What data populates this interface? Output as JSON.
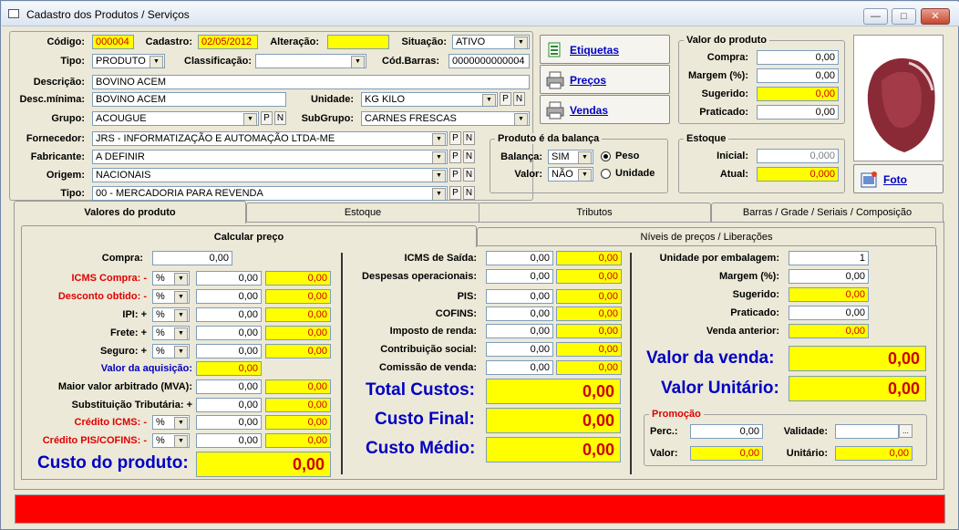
{
  "window": {
    "title": "Cadastro dos Produtos / Serviços",
    "min": "—",
    "max": "□",
    "close": "✕"
  },
  "top": {
    "codigo_label": "Código:",
    "codigo": "000004",
    "cadastro_label": "Cadastro:",
    "cadastro": "02/05/2012",
    "alteracao_label": "Alteração:",
    "alteracao": "",
    "situacao_label": "Situação:",
    "situacao": "ATIVO",
    "tipo_label": "Tipo:",
    "tipo": "PRODUTO",
    "classificacao_label": "Classificação:",
    "classificacao": "",
    "codbarras_label": "Cód.Barras:",
    "codbarras": "0000000000004",
    "descricao_label": "Descrição:",
    "descricao": "BOVINO ACEM",
    "descmin_label": "Desc.mínima:",
    "descmin": "BOVINO ACEM",
    "unidade_label": "Unidade:",
    "unidade": "KG  KILO",
    "grupo_label": "Grupo:",
    "grupo": "ACOUGUE",
    "subgrupo_label": "SubGrupo:",
    "subgrupo": "CARNES FRESCAS",
    "fornecedor_label": "Fornecedor:",
    "fornecedor": "JRS - INFORMATIZAÇÃO E AUTOMAÇÃO LTDA-ME",
    "fabricante_label": "Fabricante:",
    "fabricante": "A DEFINIR",
    "origem_label": "Origem:",
    "origem": "NACIONAIS",
    "tipo2_label": "Tipo:",
    "tipo2": "00 - MERCADORIA PARA REVENDA",
    "p": "P",
    "n": "N"
  },
  "buttons": {
    "etiquetas": "Etiquetas",
    "precos": "Preços",
    "vendas": "Vendas",
    "foto": "Foto"
  },
  "valor_produto": {
    "title": "Valor do produto",
    "compra_label": "Compra:",
    "compra": "0,00",
    "margem_label": "Margem (%):",
    "margem": "0,00",
    "sugerido_label": "Sugerido:",
    "sugerido": "0,00",
    "praticado_label": "Praticado:",
    "praticado": "0,00"
  },
  "balanca": {
    "title": "Produto é da balança",
    "balanca_label": "Balança:",
    "balanca": "SIM",
    "valor_label": "Valor:",
    "valor": "NÃO",
    "peso": "Peso",
    "unidade": "Unidade"
  },
  "estoque": {
    "title": "Estoque",
    "inicial_label": "Inicial:",
    "inicial": "0,000",
    "atual_label": "Atual:",
    "atual": "0,000"
  },
  "tabs": [
    "Valores do produto",
    "Estoque",
    "Tributos",
    "Barras / Grade / Seriais / Composição"
  ],
  "subtabs": [
    "Calcular preço",
    "Níveis de preços / Liberações"
  ],
  "left": {
    "compra_label": "Compra:",
    "compra": "0,00",
    "rows": [
      {
        "label": "ICMS Compra: -",
        "sel": "%",
        "v1": "0,00",
        "v2": "0,00",
        "color": "red"
      },
      {
        "label": "Desconto obtido: -",
        "sel": "%",
        "v1": "0,00",
        "v2": "0,00",
        "color": "red"
      },
      {
        "label": "IPI: +",
        "sel": "%",
        "v1": "0,00",
        "v2": "0,00",
        "color": "black"
      },
      {
        "label": "Frete: +",
        "sel": "%",
        "v1": "0,00",
        "v2": "0,00",
        "color": "black"
      },
      {
        "label": "Seguro: +",
        "sel": "%",
        "v1": "0,00",
        "v2": "0,00",
        "color": "black"
      }
    ],
    "aquisicao_label": "Valor da aquisição:",
    "aquisicao": "0,00",
    "mva_label": "Maior valor arbitrado (MVA):",
    "mva1": "0,00",
    "mva2": "0,00",
    "st_label": "Substituição Tributária: +",
    "st1": "0,00",
    "st2": "0,00",
    "credicms_label": "Crédito ICMS: -",
    "credicms_sel": "%",
    "credicms1": "0,00",
    "credicms2": "0,00",
    "credpis_label": "Crédito PIS/COFINS: -",
    "credpis_sel": "%",
    "credpis1": "0,00",
    "credpis2": "0,00",
    "custo_label": "Custo do produto:",
    "custo": "0,00"
  },
  "middle": {
    "rows": [
      {
        "label": "ICMS de Saída:",
        "v1": "0,00",
        "v2": "0,00"
      },
      {
        "label": "Despesas operacionais:",
        "v1": "0,00",
        "v2": "0,00"
      },
      {
        "label": "PIS:",
        "v1": "0,00",
        "v2": "0,00"
      },
      {
        "label": "COFINS:",
        "v1": "0,00",
        "v2": "0,00"
      },
      {
        "label": "Imposto de renda:",
        "v1": "0,00",
        "v2": "0,00"
      },
      {
        "label": "Contribuição social:",
        "v1": "0,00",
        "v2": "0,00"
      },
      {
        "label": "Comissão de venda:",
        "v1": "0,00",
        "v2": "0,00"
      }
    ],
    "total_label": "Total Custos:",
    "total": "0,00",
    "final_label": "Custo Final:",
    "final": "0,00",
    "medio_label": "Custo Médio:",
    "medio": "0,00"
  },
  "right": {
    "unid_label": "Unidade por embalagem:",
    "unid": "1",
    "margem_label": "Margem (%):",
    "margem": "0,00",
    "sugerido_label": "Sugerido:",
    "sugerido": "0,00",
    "praticado_label": "Praticado:",
    "praticado": "0,00",
    "anterior_label": "Venda anterior:",
    "anterior": "0,00",
    "venda_label": "Valor da venda:",
    "venda": "0,00",
    "unitario_label": "Valor Unitário:",
    "unitario": "0,00",
    "promo_title": "Promoção",
    "perc_label": "Perc.:",
    "perc": "0,00",
    "validade_label": "Validade:",
    "validade": "",
    "valor_label": "Valor:",
    "valor": "0,00",
    "unit_label": "Unitário:",
    "unit": "0,00",
    "ellipsis": "..."
  },
  "colors": {
    "highlight": "#ffff00",
    "status_bar": "#ff0000",
    "blue_text": "#0000c0",
    "red_label": "#e00000"
  }
}
